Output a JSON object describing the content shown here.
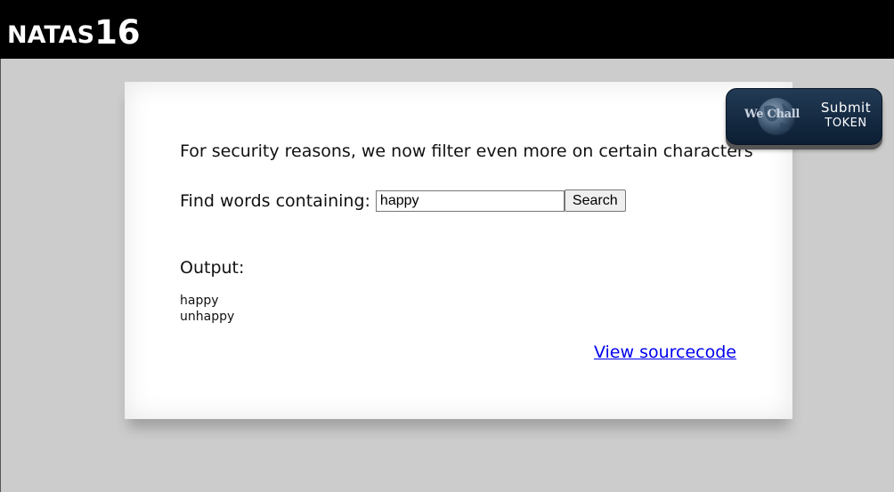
{
  "header": {
    "title_prefix": "NATAS",
    "title_number": "16"
  },
  "main": {
    "intro_text": "For security reasons, we now filter even more on certain characters",
    "search_label": "Find words containing:",
    "search_value": "happy",
    "search_button_label": "Search",
    "output_label": "Output:",
    "output_words": [
      "happy",
      "unhappy"
    ],
    "view_source_label": "View sourcecode"
  },
  "wechall_badge": {
    "logo_text": "We Chall",
    "submit_label": "Submit",
    "token_label": "TOKEN"
  },
  "colors": {
    "header_background": "#000000",
    "page_background": "#cccccc",
    "content_background": "#ffffff",
    "link": "#0000ee",
    "badge_background": "#1a2f47"
  }
}
